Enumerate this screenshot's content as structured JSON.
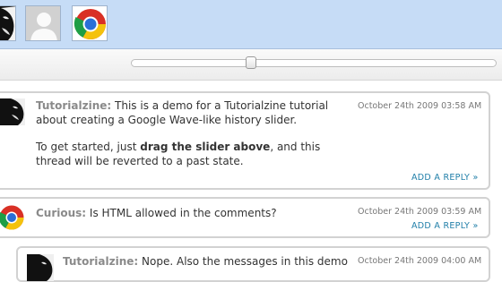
{
  "slider": {
    "position_fraction": 0.33
  },
  "comments": [
    {
      "author": "Tutorialzine:",
      "text_intro": " This is a demo for a Tutorialzine tutorial about creating a Google Wave-like history slider.",
      "text2_before": "To get started, just ",
      "text2_bold": "drag the slider above",
      "text2_after": ", and this thread will be reverted to a past state.",
      "date": "October 24th 2009 03:58 AM",
      "reply": "ADD A REPLY »"
    },
    {
      "author": "Curious:",
      "text": " Is HTML allowed in the comments?",
      "date": "October 24th 2009 03:59 AM",
      "reply": "ADD A REPLY »"
    },
    {
      "author": "Tutorialzine:",
      "text": " Nope. Also the messages in this demo",
      "date": "October 24th 2009 04:00 AM"
    }
  ]
}
